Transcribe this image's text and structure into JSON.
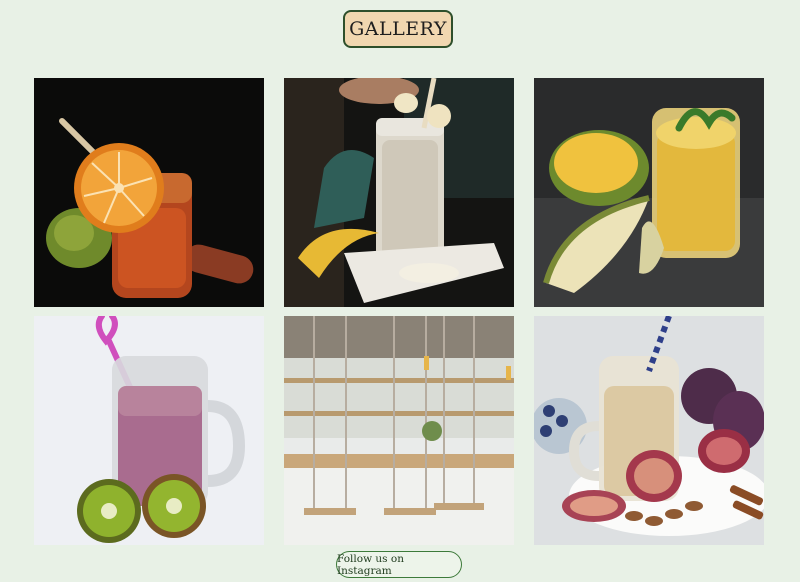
{
  "header": {
    "gallery_label": "GALLERY"
  },
  "gallery": {
    "images": [
      {
        "name": "orange-carrot-smoothie-photo"
      },
      {
        "name": "banana-smoothie-photo"
      },
      {
        "name": "mango-pear-smoothie-photo"
      },
      {
        "name": "berry-kiwi-smoothie-photo"
      },
      {
        "name": "cafe-swings-interior-photo"
      },
      {
        "name": "fig-almond-smoothie-photo"
      }
    ]
  },
  "footer": {
    "instagram_label": "Follow us on Instagram"
  },
  "colors": {
    "background": "#e8f1e6",
    "button_fill": "#f1d7b0",
    "button_border": "#2e4f2b",
    "instagram_border": "#3d7a3a"
  }
}
